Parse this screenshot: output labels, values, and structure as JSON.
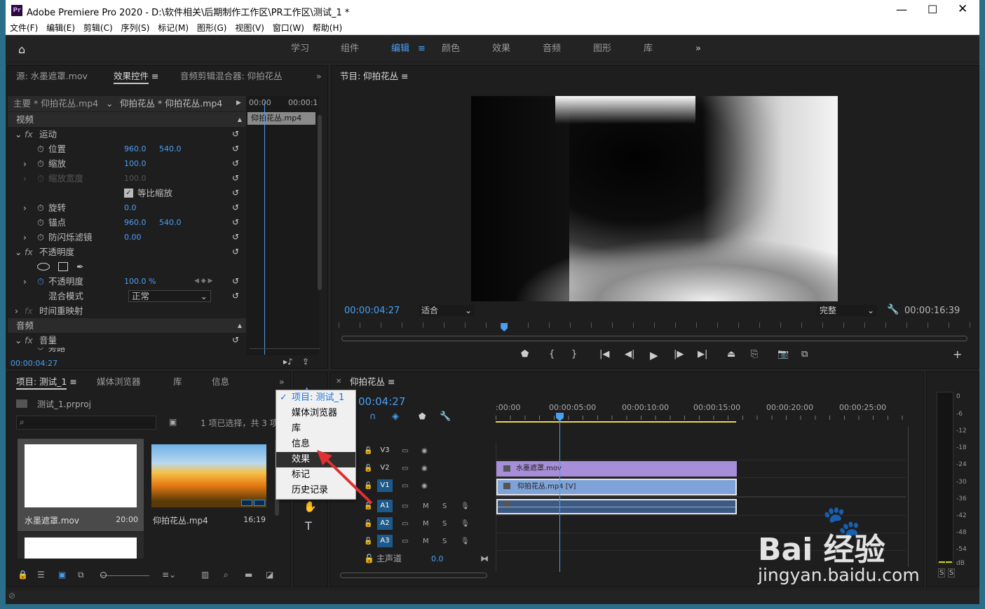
{
  "window": {
    "app_icon": "Pr",
    "title": "Adobe Premiere Pro 2020 - D:\\软件相关\\后期制作工作区\\PR工作区\\测试_1 *",
    "minimize_icon": "minimize-icon",
    "maximize_icon": "maximize-icon",
    "close_icon": "close-icon"
  },
  "menubar": [
    "文件(F)",
    "编辑(E)",
    "剪辑(C)",
    "序列(S)",
    "标记(M)",
    "图形(G)",
    "视图(V)",
    "窗口(W)",
    "帮助(H)"
  ],
  "workspaces": {
    "items": [
      "学习",
      "组件",
      "编辑",
      "颜色",
      "效果",
      "音频",
      "图形",
      "库"
    ],
    "active": "编辑",
    "more": "»"
  },
  "source_panel": {
    "tabs": [
      "源: 水墨遮罩.mov",
      "效果控件",
      "音频剪辑混合器: 仰拍花丛"
    ],
    "active_tab": "效果控件",
    "master_label": "主要 * 仰拍花丛.mp4",
    "clip_label": "仰拍花丛 * 仰拍花丛.mp4",
    "ruler": [
      "00:00",
      "00:00:1"
    ],
    "mini_clip": "仰拍花丛.mp4",
    "video_header": "视频",
    "motion": "运动",
    "position_label": "位置",
    "position_x": "960.0",
    "position_y": "540.0",
    "scale_label": "缩放",
    "scale_value": "100.0",
    "scale_width_label": "缩放宽度",
    "scale_width_value": "100.0",
    "uniform_scale_label": "等比缩放",
    "rotation_label": "旋转",
    "rotation_value": "0.0",
    "anchor_label": "锚点",
    "anchor_x": "960.0",
    "anchor_y": "540.0",
    "antiflicker_label": "防闪烁滤镜",
    "antiflicker_value": "0.00",
    "opacity_header": "不透明度",
    "opacity_label": "不透明度",
    "opacity_value": "100.0 %",
    "blend_label": "混合模式",
    "blend_value": "正常",
    "time_remap": "时间重映射",
    "audio_header": "音频",
    "volume": "音量",
    "bypass": "旁路",
    "timecode": "00:00:04:27"
  },
  "program_monitor": {
    "title": "节目: 仰拍花丛",
    "timecode": "00:00:04:27",
    "fit": "适合",
    "quality": "完整",
    "duration": "00:00:16:39",
    "playhead_fraction": 0.26
  },
  "project_panel": {
    "tabs": [
      "项目: 测试_1",
      "媒体浏览器",
      "库",
      "信息",
      "»"
    ],
    "project_file": "测试_1.prproj",
    "selection_info": "1 项已选择，共 3 项",
    "items": [
      {
        "name": "水墨遮罩.mov",
        "duration": "20:00"
      },
      {
        "name": "仰拍花丛.mp4",
        "duration": "16;19"
      }
    ]
  },
  "dropdown_menu": {
    "items": [
      "项目: 测试_1",
      "媒体浏览器",
      "库",
      "信息",
      "效果",
      "标记",
      "历史记录"
    ],
    "checked": "项目: 测试_1",
    "highlighted": "效果"
  },
  "timeline": {
    "title": "仰拍花丛",
    "timecode": "00:04:27",
    "ruler": [
      ":00:00",
      "00:00:05:00",
      "00:00:10:00",
      "00:00:15:00",
      "00:00:20:00",
      "00:00:25:00"
    ],
    "tracks": [
      {
        "name": "V3"
      },
      {
        "name": "V2"
      },
      {
        "name": "V1"
      },
      {
        "name": "A1"
      },
      {
        "name": "A2"
      },
      {
        "name": "A3"
      }
    ],
    "master": "主声道",
    "master_value": "0.0",
    "clip_v2": "水墨遮罩.mov",
    "clip_v1": "仰拍花丛.mp4 [V]"
  },
  "audio_meter": {
    "labels": [
      "0",
      "-6",
      "-12",
      "-18",
      "-24",
      "-30",
      "-36",
      "-42",
      "-48",
      "-54",
      "dB"
    ],
    "solo": [
      "S",
      "S"
    ]
  },
  "watermark": {
    "brand": "Bai 经验",
    "url": "jingyan.baidu.com"
  }
}
